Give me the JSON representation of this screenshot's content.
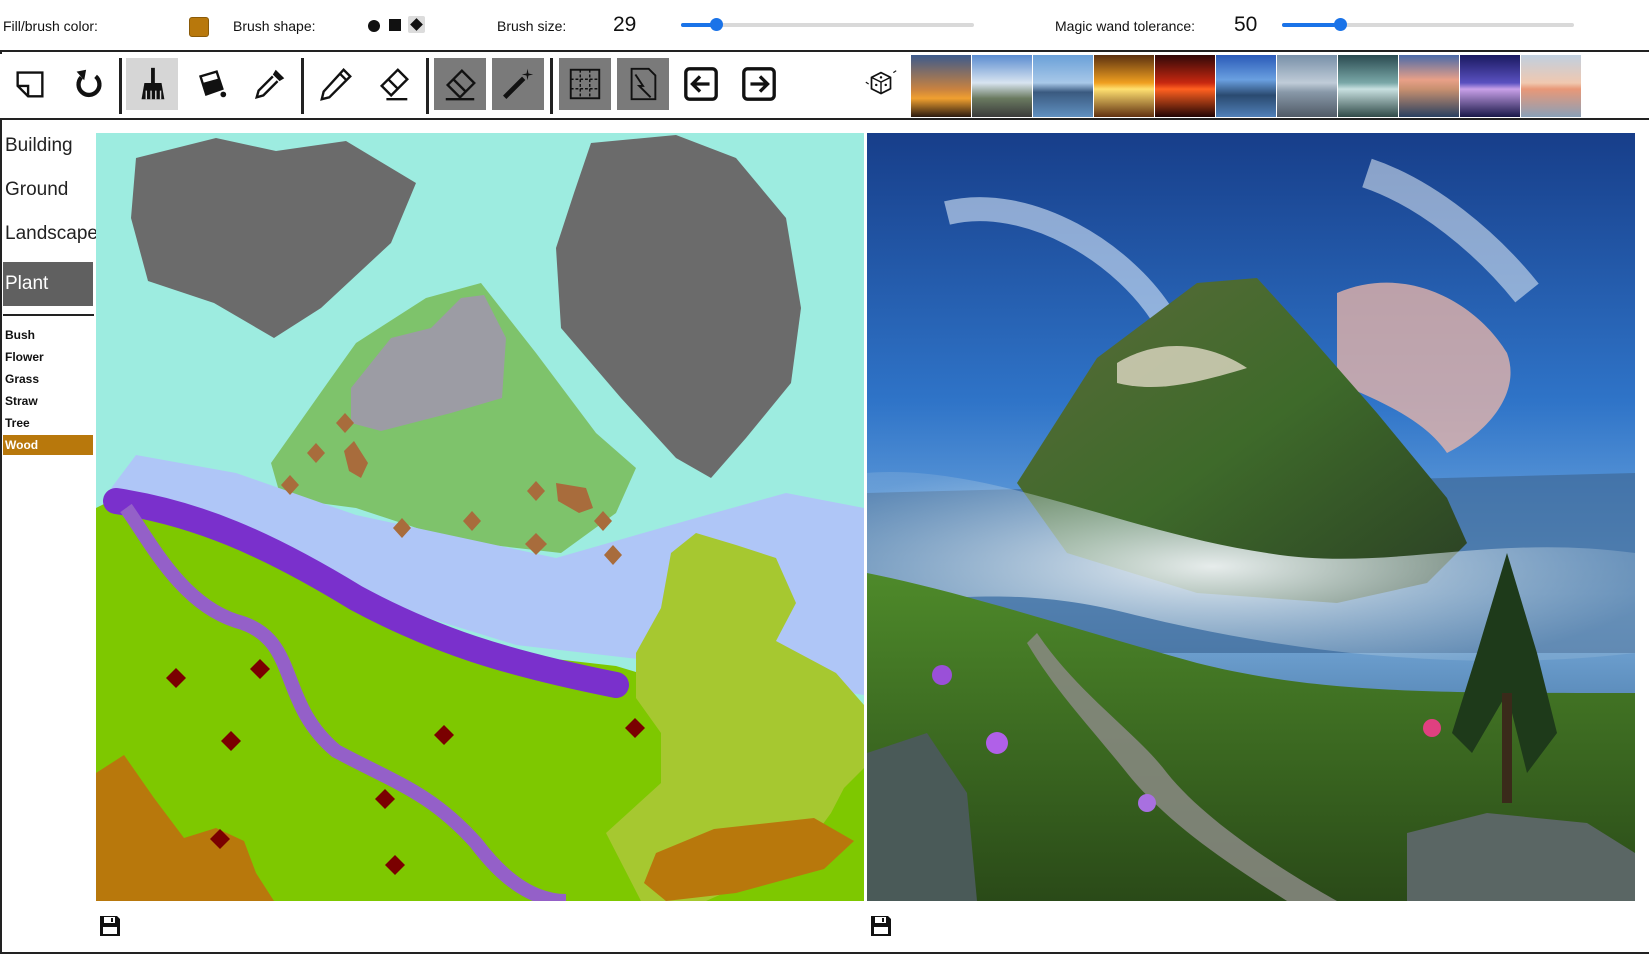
{
  "settings": {
    "fill_color_label": "Fill/brush color:",
    "fill_color": "#b8780c",
    "brush_shape_label": "Brush shape:",
    "brush_shapes": [
      "circle",
      "square",
      "diamond"
    ],
    "brush_shape_selected": "diamond",
    "brush_size_label": "Brush size:",
    "brush_size": "29",
    "brush_size_fraction": 0.12,
    "magic_wand_label": "Magic wand tolerance:",
    "magic_wand_tolerance": "50",
    "magic_wand_fraction": 0.2
  },
  "toolbar": {
    "tools": [
      {
        "name": "new-canvas-icon"
      },
      {
        "name": "undo-icon"
      },
      {
        "name": "brush-icon",
        "state": "selected"
      },
      {
        "name": "fill-bucket-icon"
      },
      {
        "name": "eyedropper-icon"
      },
      {
        "name": "pencil-icon"
      },
      {
        "name": "eraser-pencil-icon"
      },
      {
        "name": "eraser-icon",
        "state": "toggled"
      },
      {
        "name": "magic-wand-icon",
        "state": "toggled"
      },
      {
        "name": "segment-grid-icon",
        "state": "toggled"
      },
      {
        "name": "edge-map-icon",
        "state": "toggled"
      },
      {
        "name": "arrow-left-icon"
      },
      {
        "name": "arrow-right-icon"
      },
      {
        "name": "random-dice-icon"
      }
    ],
    "style_thumbnails": [
      "sunset-silhouette",
      "road-clouds",
      "calm-lake",
      "golden-sunset",
      "red-sky",
      "lake-mountains",
      "gray-sea",
      "misty-lake",
      "pink-clouds",
      "purple-dusk",
      "pastel-horizon"
    ]
  },
  "sidebar": {
    "categories": [
      {
        "label": "Building"
      },
      {
        "label": "Ground"
      },
      {
        "label": "Landscape"
      },
      {
        "label": "Plant",
        "active": true
      }
    ],
    "subcategories": [
      {
        "label": "Bush"
      },
      {
        "label": "Flower"
      },
      {
        "label": "Grass"
      },
      {
        "label": "Straw"
      },
      {
        "label": "Tree"
      },
      {
        "label": "Wood",
        "active": true
      }
    ]
  },
  "colors": {
    "sky": "#9dece0",
    "cloud": "#6b6b6b",
    "mountain": "#7ec36b",
    "rock": "#9c9ca4",
    "fog": "#afc6f7",
    "river": "#7a30cc",
    "path": "#9460c8",
    "grass": "#7ec800",
    "bush": "#a6c830",
    "wood": "#b8780c",
    "flower": "#7a0000",
    "tree-patch": "#a86c3c"
  }
}
